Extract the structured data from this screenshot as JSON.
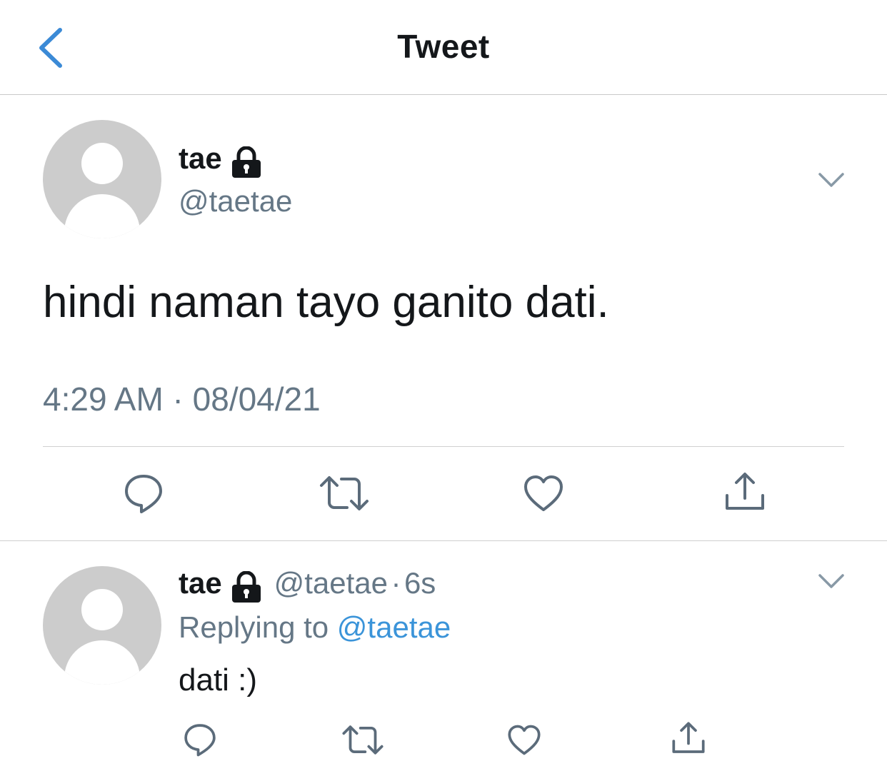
{
  "header": {
    "title": "Tweet"
  },
  "main_tweet": {
    "display_name": "tae",
    "handle": "@taetae",
    "text": "hindi naman tayo ganito dati.",
    "timestamp": "4:29 AM · 08/04/21"
  },
  "reply_tweet": {
    "display_name": "tae",
    "handle": "@taetae",
    "separator": "·",
    "age": "6s",
    "replying_prefix": "Replying to",
    "replying_to": "@taetae",
    "text": "dati :)"
  },
  "icons": [
    "back-chevron-icon",
    "lock-icon",
    "chevron-down-icon",
    "reply-icon",
    "retweet-icon",
    "like-icon",
    "share-icon"
  ],
  "colors": {
    "link": "#3b94d9",
    "muted": "#657786",
    "text": "#14171a",
    "avatar": "#cccccc"
  }
}
